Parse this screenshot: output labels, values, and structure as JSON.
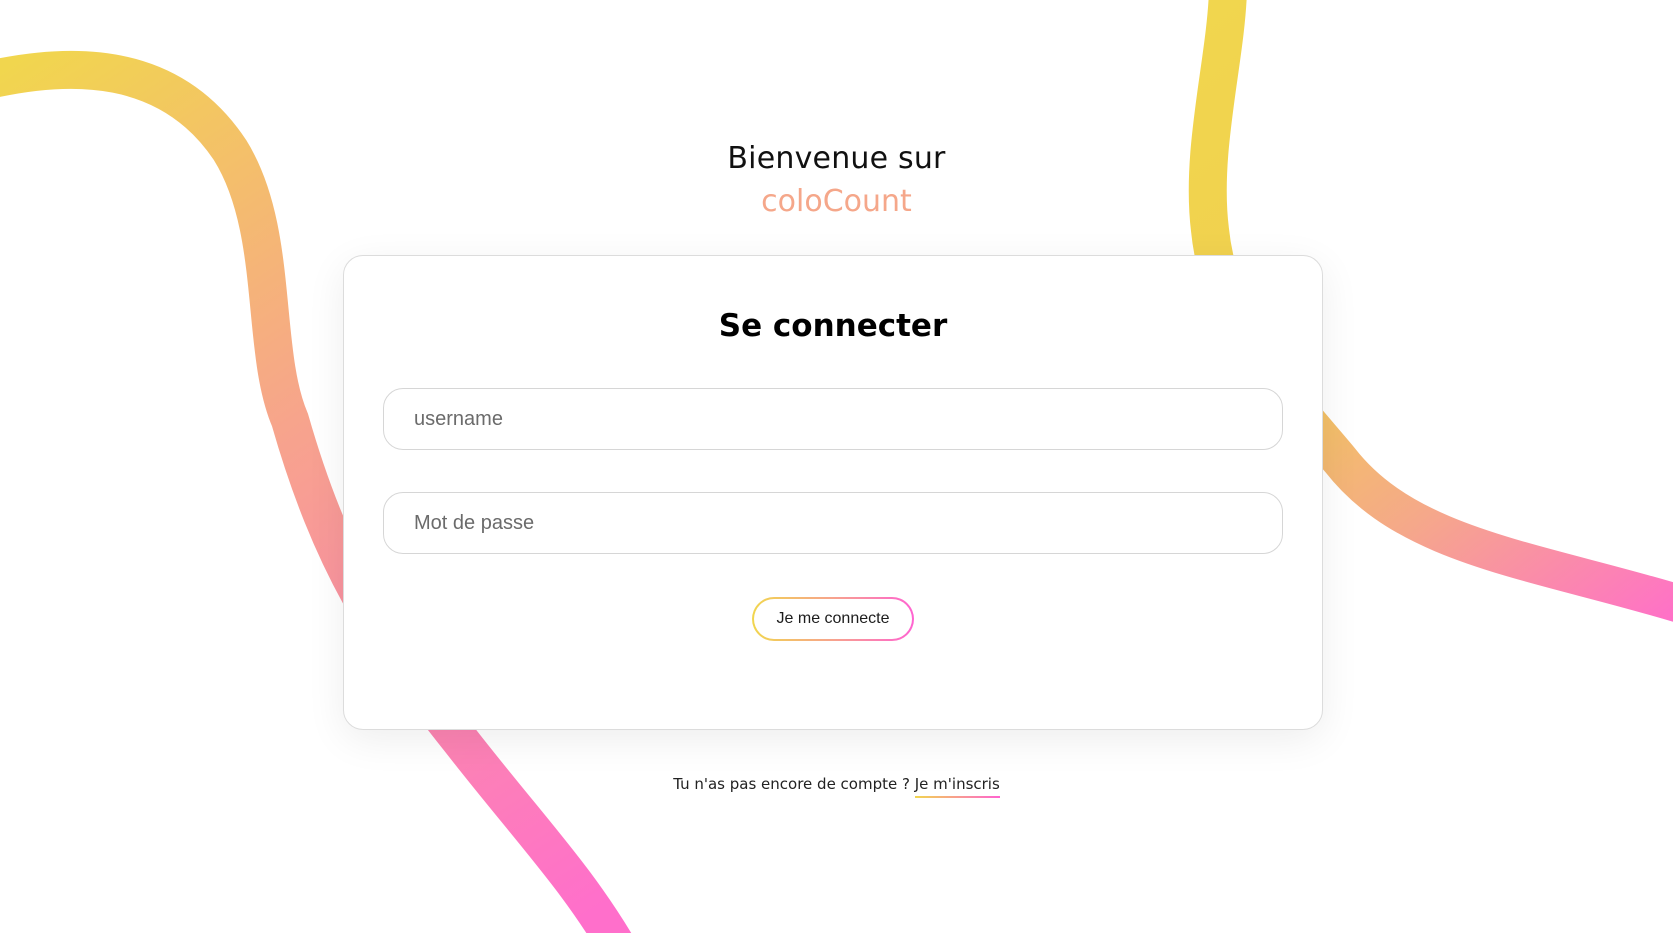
{
  "welcome": {
    "line1": "Bienvenue sur",
    "brand": "coloCount"
  },
  "login": {
    "title": "Se connecter",
    "username_placeholder": "username",
    "password_placeholder": "Mot de passe",
    "submit_label": "Je me connecte"
  },
  "signup": {
    "prompt": "Tu n'as pas encore de compte ?",
    "link_label": "Je m'inscris"
  },
  "theme": {
    "gradient_start": "#f1d64e",
    "gradient_mid": "#f7a38d",
    "gradient_end": "#ff63d1",
    "brand_color": "#f5a78a"
  }
}
